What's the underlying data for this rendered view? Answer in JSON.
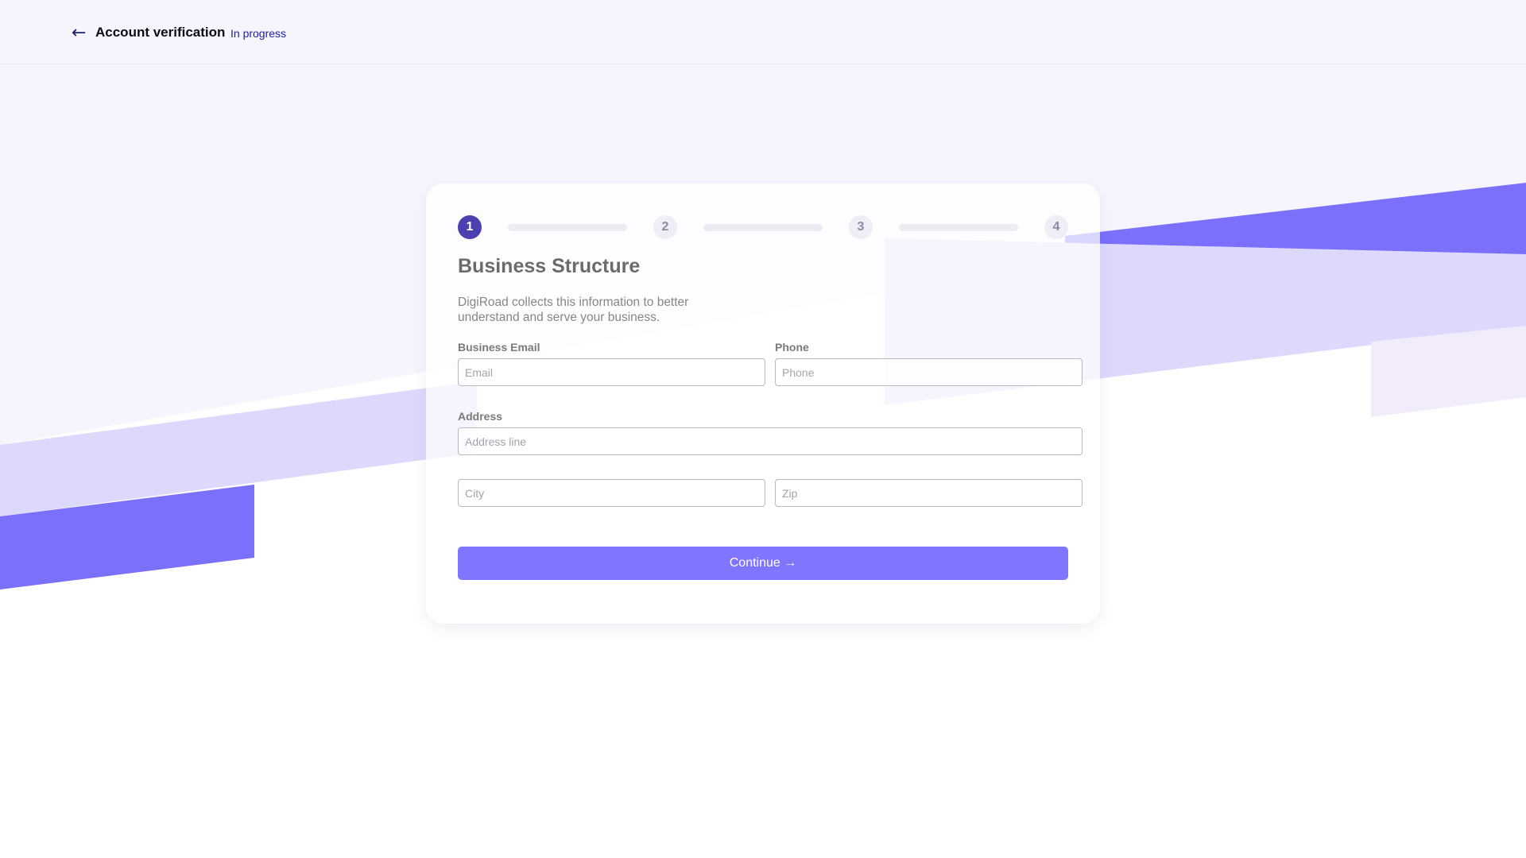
{
  "header": {
    "back_icon": "arrow-left-icon",
    "title": "Account verification",
    "status": "In progress"
  },
  "stepper": {
    "steps": [
      "1",
      "2",
      "3",
      "4"
    ],
    "active_step": 1
  },
  "form": {
    "heading": "Business Structure",
    "description": "DigiRoad collects this information to better understand and serve your business.",
    "fields": {
      "business_email": {
        "label": "Business Email",
        "placeholder": "Email",
        "value": ""
      },
      "phone": {
        "label": "Phone",
        "placeholder": "Phone",
        "value": ""
      },
      "address": {
        "label": "Address",
        "placeholder": "Address line",
        "value": ""
      },
      "city": {
        "placeholder": "City",
        "value": ""
      },
      "zip": {
        "placeholder": "Zip",
        "value": ""
      }
    },
    "continue_label": "Continue →"
  },
  "colors": {
    "primary": "#8075ff",
    "active_step": "#4c3fb0",
    "stripe_dark": "#7b70fc",
    "stripe_light": "#dcd9fc",
    "stripe_pink": "#f1ebfb",
    "background": "#f6f5fd"
  }
}
